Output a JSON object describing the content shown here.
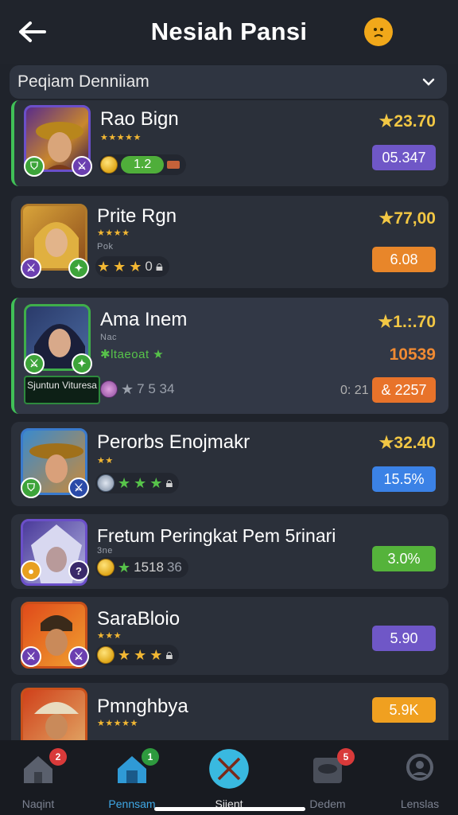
{
  "header": {
    "title": "Nesiah Pansi"
  },
  "dropdown": {
    "label": "Peqiam Denniiam"
  },
  "items": [
    {
      "name": "Rao Bign",
      "stars": "★★★★★",
      "rating": "★23.70",
      "pill": "1.2",
      "value": "05.347",
      "value_color": "#6f57c7"
    },
    {
      "name": "Prite Rgn",
      "stars": "★★★★",
      "sub": "Pok",
      "rating": "★77,00",
      "pill_text": "0",
      "value": "6.08",
      "value_color": "#e8862a"
    },
    {
      "name": "Ama Inem",
      "sub": "Nac",
      "stars": "✱ltaeoat ★",
      "rating": "★1.:.70",
      "orange": "10539",
      "chip": "7 5 34",
      "side": "0: 21",
      "value": "& 2257",
      "value_color": "#e8732a",
      "caption": "Sjuntun Vituresa"
    },
    {
      "name": "Perorbs Enojmakr",
      "stars": "★★",
      "rating": "★32.40",
      "value": "15.5%",
      "value_color": "#3b82e6"
    },
    {
      "name": "Fretum Peringkat Pem 5rinari",
      "sub": "3ne",
      "pill_text": "1518",
      "pill_extra": "36",
      "value": "3.0%",
      "value_color": "#55b33b"
    },
    {
      "name": "SaraBloio",
      "stars": "★★★",
      "value": "5.90",
      "value_color": "#6f57c7"
    },
    {
      "name": "Pmnghbya",
      "stars": "★★★★★",
      "value": "5.9K",
      "value_color": "#f0a020"
    }
  ],
  "nav": {
    "items": [
      {
        "label": "Naqint",
        "badge": "2",
        "badge_color": "#d93a3a"
      },
      {
        "label": "Pennsam",
        "badge": "1",
        "badge_color": "#2e9a3e"
      },
      {
        "label": "Sjient"
      },
      {
        "label": "Dedem",
        "badge": "5",
        "badge_color": "#d93a3a"
      },
      {
        "label": "Lenslas"
      }
    ]
  },
  "colors": {
    "accent": "#3fa8e6",
    "rating": "#f2c744",
    "active_border": "#40c057"
  },
  "icons": [
    "back-arrow-icon",
    "emoji-icon",
    "chevron-down-icon",
    "home-icon",
    "shop-icon",
    "crossed-swords-icon",
    "chest-icon",
    "search-user-icon"
  ]
}
